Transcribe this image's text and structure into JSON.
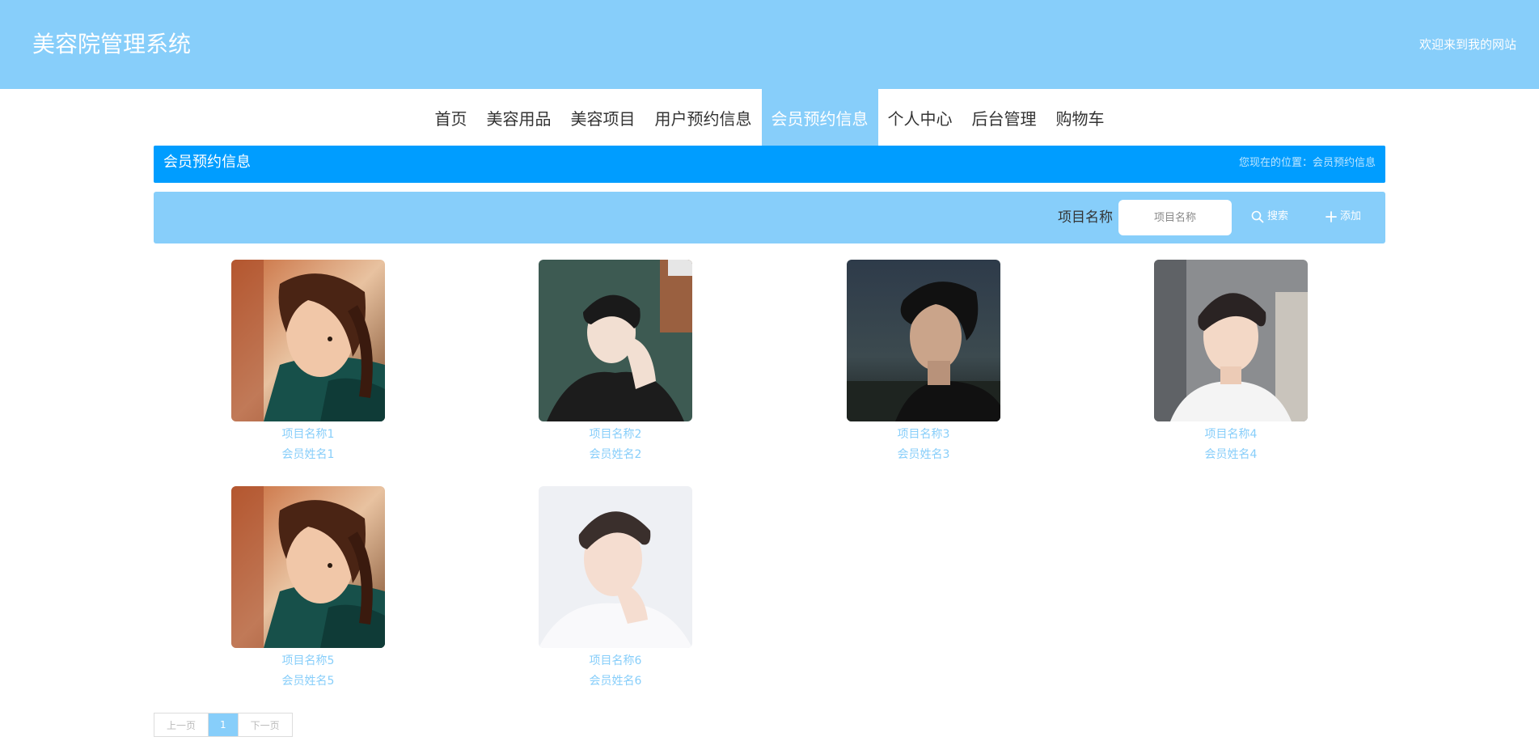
{
  "header": {
    "site_title": "美容院管理系统",
    "welcome": "欢迎来到我的网站"
  },
  "nav": {
    "items": [
      {
        "label": "首页"
      },
      {
        "label": "美容用品"
      },
      {
        "label": "美容项目"
      },
      {
        "label": "用户预约信息"
      },
      {
        "label": "会员预约信息",
        "active": true
      },
      {
        "label": "个人中心"
      },
      {
        "label": "后台管理"
      },
      {
        "label": "购物车"
      }
    ]
  },
  "breadcrumb": {
    "title": "会员预约信息",
    "location": "您现在的位置：会员预约信息"
  },
  "search": {
    "label": "项目名称",
    "placeholder": "项目名称",
    "search_label": "搜索",
    "add_label": "添加"
  },
  "cards": [
    {
      "project": "项目名称1",
      "member": "会员姓名1",
      "photo": "woman-profile"
    },
    {
      "project": "项目名称2",
      "member": "会员姓名2",
      "photo": "man-hand-on-face"
    },
    {
      "project": "项目名称3",
      "member": "会员姓名3",
      "photo": "man-side-profile-dusk"
    },
    {
      "project": "项目名称4",
      "member": "会员姓名4",
      "photo": "man-car-selfie"
    },
    {
      "project": "项目名称5",
      "member": "会员姓名5",
      "photo": "woman-profile"
    },
    {
      "project": "项目名称6",
      "member": "会员姓名6",
      "photo": "man-white-shirt"
    }
  ],
  "pagination": {
    "prev": "上一页",
    "current": "1",
    "next": "下一页"
  },
  "colors": {
    "header_bg": "#87cefa",
    "crumb_bg": "#009dff",
    "accent_text": "#87cefa"
  }
}
